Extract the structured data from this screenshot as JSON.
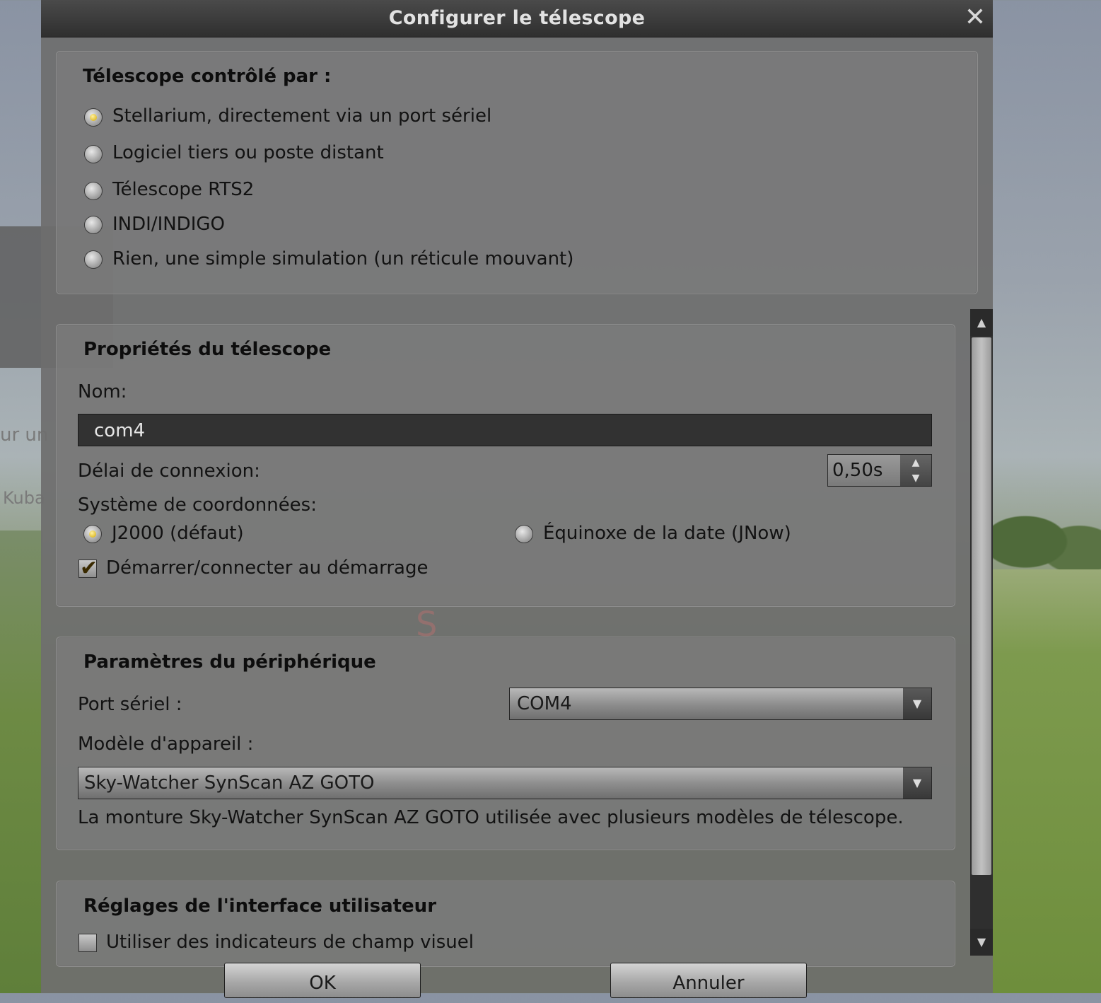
{
  "background": {
    "text_fragments": [
      "ur un",
      "Kuba"
    ]
  },
  "dialog": {
    "title": "Configurer le télescope",
    "close_symbol": "✕",
    "control": {
      "title": "Télescope contrôlé par :",
      "options": [
        {
          "label": "Stellarium, directement via un port sériel",
          "selected": true
        },
        {
          "label": "Logiciel tiers ou poste distant",
          "selected": false
        },
        {
          "label": "Télescope RTS2",
          "selected": false
        },
        {
          "label": "INDI/INDIGO",
          "selected": false
        },
        {
          "label": "Rien, une simple simulation (un réticule mouvant)",
          "selected": false
        }
      ]
    },
    "properties": {
      "title": "Propriétés du télescope",
      "name_label": "Nom:",
      "name_value": "com4",
      "delay_label": "Délai de connexion:",
      "delay_value": "0,50s",
      "coords_label": "Système de coordonnées:",
      "coords_j2000": "J2000 (défaut)",
      "coords_jnow": "Équinoxe de la date (JNow)",
      "coords_selected": "J2000",
      "autostart_label": "Démarrer/connecter au démarrage",
      "autostart_checked": true
    },
    "device": {
      "title": "Paramètres du périphérique",
      "port_label": "Port sériel :",
      "port_value": "COM4",
      "model_label": "Modèle d'appareil :",
      "model_value": "Sky-Watcher SynScan AZ GOTO",
      "model_description": "La monture Sky-Watcher SynScan AZ GOTO utilisée avec plusieurs modèles de télescope."
    },
    "ui_settings": {
      "title": "Réglages de l'interface utilisateur",
      "fov_label": "Utiliser des indicateurs de champ visuel",
      "fov_checked": false
    },
    "buttons": {
      "ok": "OK",
      "cancel": "Annuler"
    },
    "overlay_letter": "S",
    "accent_color": "#d4a800"
  }
}
